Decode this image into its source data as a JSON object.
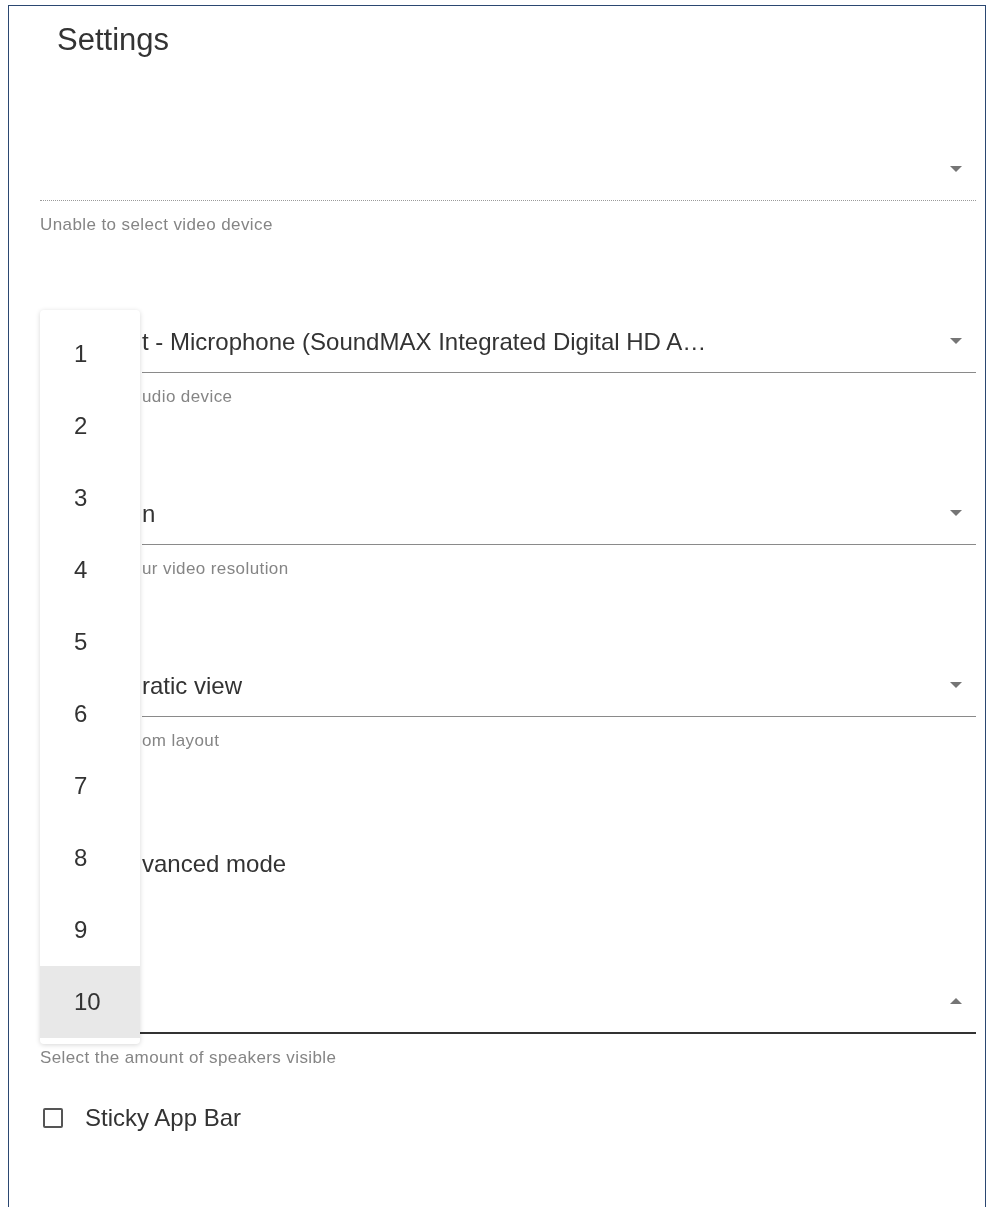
{
  "title": "Settings",
  "fields": [
    {
      "kind": "select",
      "disabled": true,
      "open": false,
      "covered": false,
      "helper": "Unable to select video device"
    },
    {
      "kind": "select",
      "disabled": false,
      "open": false,
      "covered": true,
      "value": "t - Microphone (SoundMAX Integrated Digital HD A…",
      "helper": "udio device"
    },
    {
      "kind": "select",
      "disabled": false,
      "open": false,
      "covered": true,
      "value": "n",
      "helper": "ur video resolution"
    },
    {
      "kind": "select",
      "disabled": false,
      "open": false,
      "covered": true,
      "value": "ratic view",
      "helper": "om layout"
    },
    {
      "kind": "label",
      "covered": true,
      "value": "vanced mode"
    },
    {
      "kind": "select",
      "disabled": false,
      "open": true,
      "covered": false,
      "helper": "Select the amount of speakers visible"
    },
    {
      "kind": "checkbox",
      "checked": false,
      "value": "Sticky App Bar"
    }
  ],
  "menu": {
    "options": [
      {
        "label": "1",
        "selected": false
      },
      {
        "label": "2",
        "selected": false
      },
      {
        "label": "3",
        "selected": false
      },
      {
        "label": "4",
        "selected": false
      },
      {
        "label": "5",
        "selected": false
      },
      {
        "label": "6",
        "selected": false
      },
      {
        "label": "7",
        "selected": false
      },
      {
        "label": "8",
        "selected": false
      },
      {
        "label": "9",
        "selected": false
      },
      {
        "label": "10",
        "selected": true
      }
    ]
  }
}
